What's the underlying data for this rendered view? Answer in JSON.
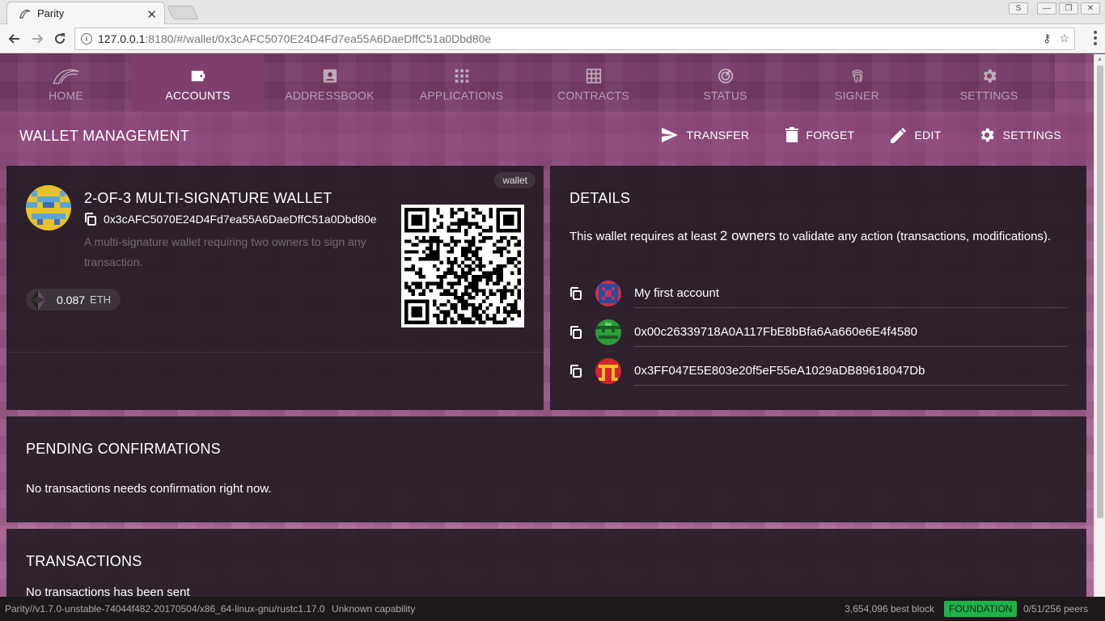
{
  "browser": {
    "tab_title": "Parity",
    "url_host": "127.0.0.1",
    "url_rest": ":8180/#/wallet/0x3cAFC5070E24D4Fd7ea55A6DaeDffC51a0Dbd80e"
  },
  "nav": {
    "items": [
      {
        "label": "HOME",
        "icon": "parity-logo-icon"
      },
      {
        "label": "ACCOUNTS",
        "icon": "wallet-icon"
      },
      {
        "label": "ADDRESSBOOK",
        "icon": "contacts-icon"
      },
      {
        "label": "APPLICATIONS",
        "icon": "apps-grid-icon"
      },
      {
        "label": "CONTRACTS",
        "icon": "grid-icon"
      },
      {
        "label": "STATUS",
        "icon": "track-changes-icon"
      },
      {
        "label": "SIGNER",
        "icon": "fingerprint-icon"
      },
      {
        "label": "SETTINGS",
        "icon": "gear-icon"
      }
    ],
    "active": "ACCOUNTS"
  },
  "titlebar": {
    "title": "WALLET MANAGEMENT",
    "transfer_label": "TRANSFER",
    "forget_label": "FORGET",
    "edit_label": "EDIT",
    "settings_label": "SETTINGS"
  },
  "wallet": {
    "tag": "wallet",
    "name": "2-OF-3 MULTI-SIGNATURE WALLET",
    "address": "0x3cAFC5070E24D4Fd7ea55A6DaeDffC51a0Dbd80e",
    "description": "A multi-signature wallet requiring two owners to sign any transaction.",
    "balance_value": "0.087",
    "balance_unit": "ETH"
  },
  "details": {
    "title": "DETAILS",
    "text_before": "This wallet requires at least ",
    "owners_count_text": "2 owners",
    "text_after": "  to validate any action (transactions, modifications).",
    "owners": [
      {
        "name": "My first account",
        "avatar_color": "#cf2f4f"
      },
      {
        "name": "0x00c26339718A0A117FbE8bBfa6Aa660e6E4f4580",
        "avatar_color": "#2c9c3a"
      },
      {
        "name": "0x3FF047E5E803e20f5eF55eA1029aDB89618047Db",
        "avatar_color": "#d4242c"
      }
    ]
  },
  "pending": {
    "title": "PENDING CONFIRMATIONS",
    "text": "No transactions needs confirmation right now."
  },
  "transactions": {
    "title": "TRANSACTIONS",
    "text": "No transactions has been sent"
  },
  "status": {
    "version": "Parity//v1.7.0-unstable-74044f482-20170504/x86_64-linux-gnu/rustc1.17.0",
    "capability": "Unknown capability",
    "best_block": "3,654,096 best block",
    "chain": "FOUNDATION",
    "peers": "0/51/256 peers"
  },
  "colors": {
    "accent": "#8a4a78",
    "card": "#261c26",
    "chain_badge": "#1db24a"
  }
}
